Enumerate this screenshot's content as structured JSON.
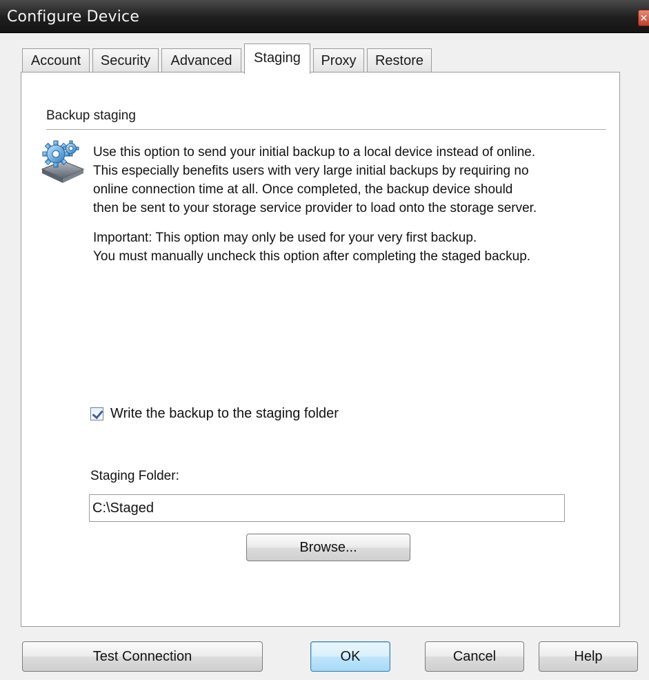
{
  "window": {
    "title": "Configure Device",
    "close_glyph": "✕"
  },
  "tabs": [
    {
      "label": "Account",
      "active": false
    },
    {
      "label": "Security",
      "active": false
    },
    {
      "label": "Advanced",
      "active": false
    },
    {
      "label": "Staging",
      "active": true
    },
    {
      "label": "Proxy",
      "active": false
    },
    {
      "label": "Restore",
      "active": false
    }
  ],
  "staging": {
    "section_title": "Backup staging",
    "icon": "gear-icon",
    "description_lines": [
      "Use this option to send your initial backup to a local device instead of online.",
      "This especially benefits users with very large initial backups by requiring no",
      "online connection time at all. Once completed, the backup device should",
      "then be sent to your storage service provider to load onto the storage server."
    ],
    "important_lines": [
      "Important: This option may only be used for your very first backup.",
      "You must manually uncheck this option after completing the staged backup."
    ],
    "checkbox": {
      "label": "Write the backup to the staging folder",
      "checked": true
    },
    "folder_label": "Staging Folder:",
    "folder_value": "C:\\Staged",
    "browse_label": "Browse..."
  },
  "footer": {
    "test_connection": "Test Connection",
    "ok": "OK",
    "cancel": "Cancel",
    "help": "Help"
  },
  "colors": {
    "accent": "#3c7fb1",
    "titlebar": "#1e1e1e",
    "close": "#c0402a"
  }
}
